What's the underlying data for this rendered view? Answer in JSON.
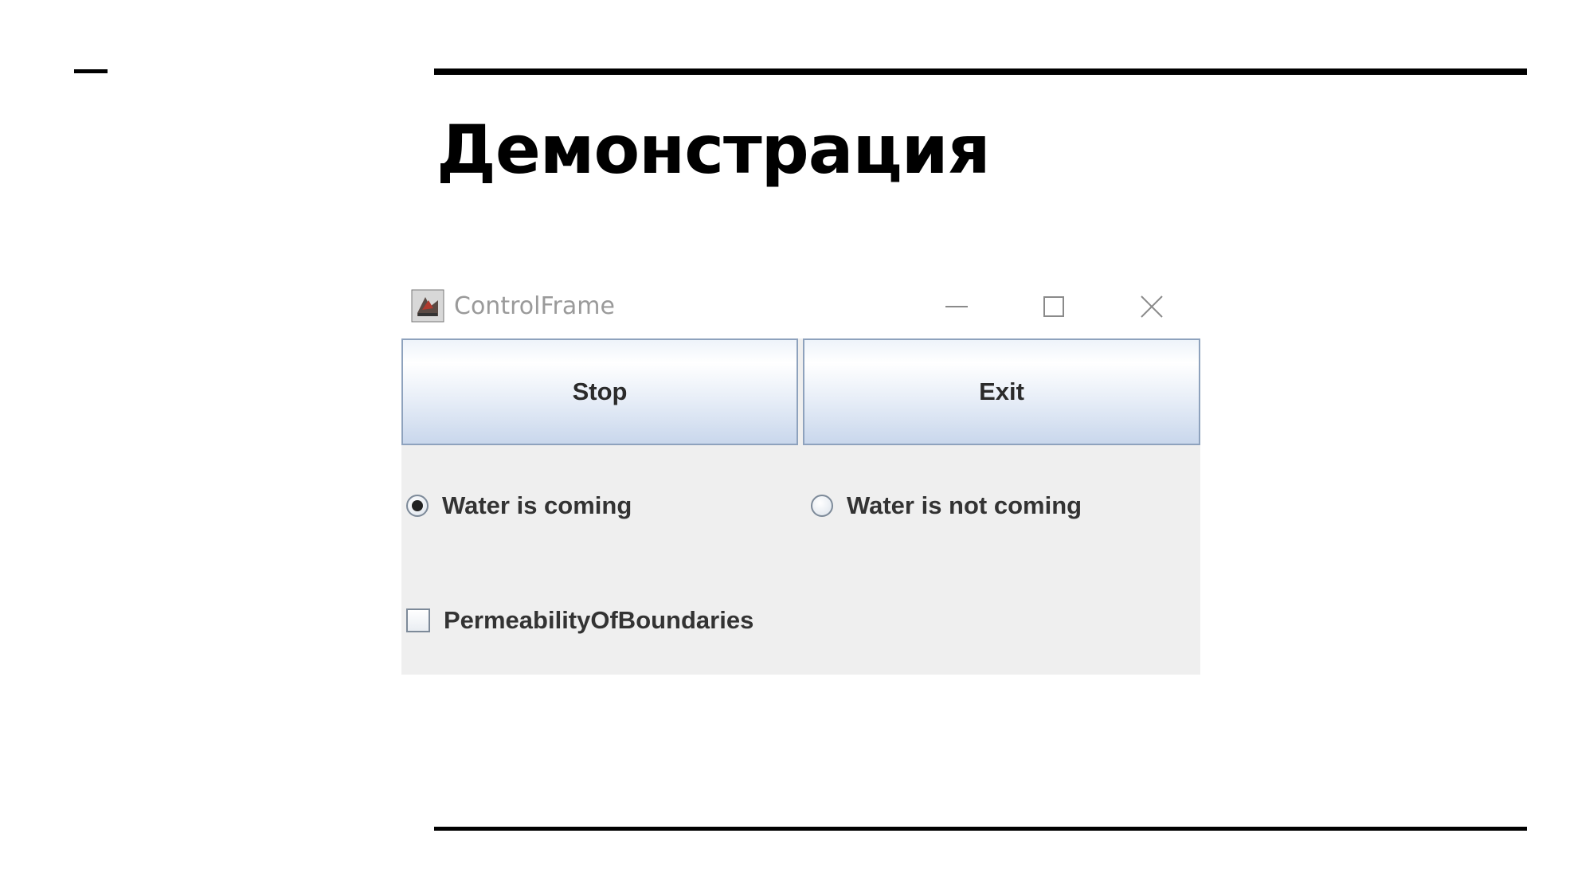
{
  "slide": {
    "title": "Демонстрация"
  },
  "window": {
    "title": "ControlFrame",
    "icon": "java-cup-icon",
    "controls": [
      "minimize-icon",
      "maximize-icon",
      "close-icon"
    ]
  },
  "buttons": {
    "stop_label": "Stop",
    "exit_label": "Exit"
  },
  "radio_group": {
    "options": [
      {
        "label": "Water is coming",
        "selected": true
      },
      {
        "label": "Water is not coming",
        "selected": false
      }
    ]
  },
  "checkbox": {
    "label": "PermeabilityOfBoundaries",
    "checked": false
  },
  "colors": {
    "window_background": "#efefef",
    "button_gradient_top": "#ffffff",
    "button_gradient_bottom": "#c9d7ec",
    "button_border": "#8ea2bd",
    "title_text": "#9a9a9a"
  }
}
